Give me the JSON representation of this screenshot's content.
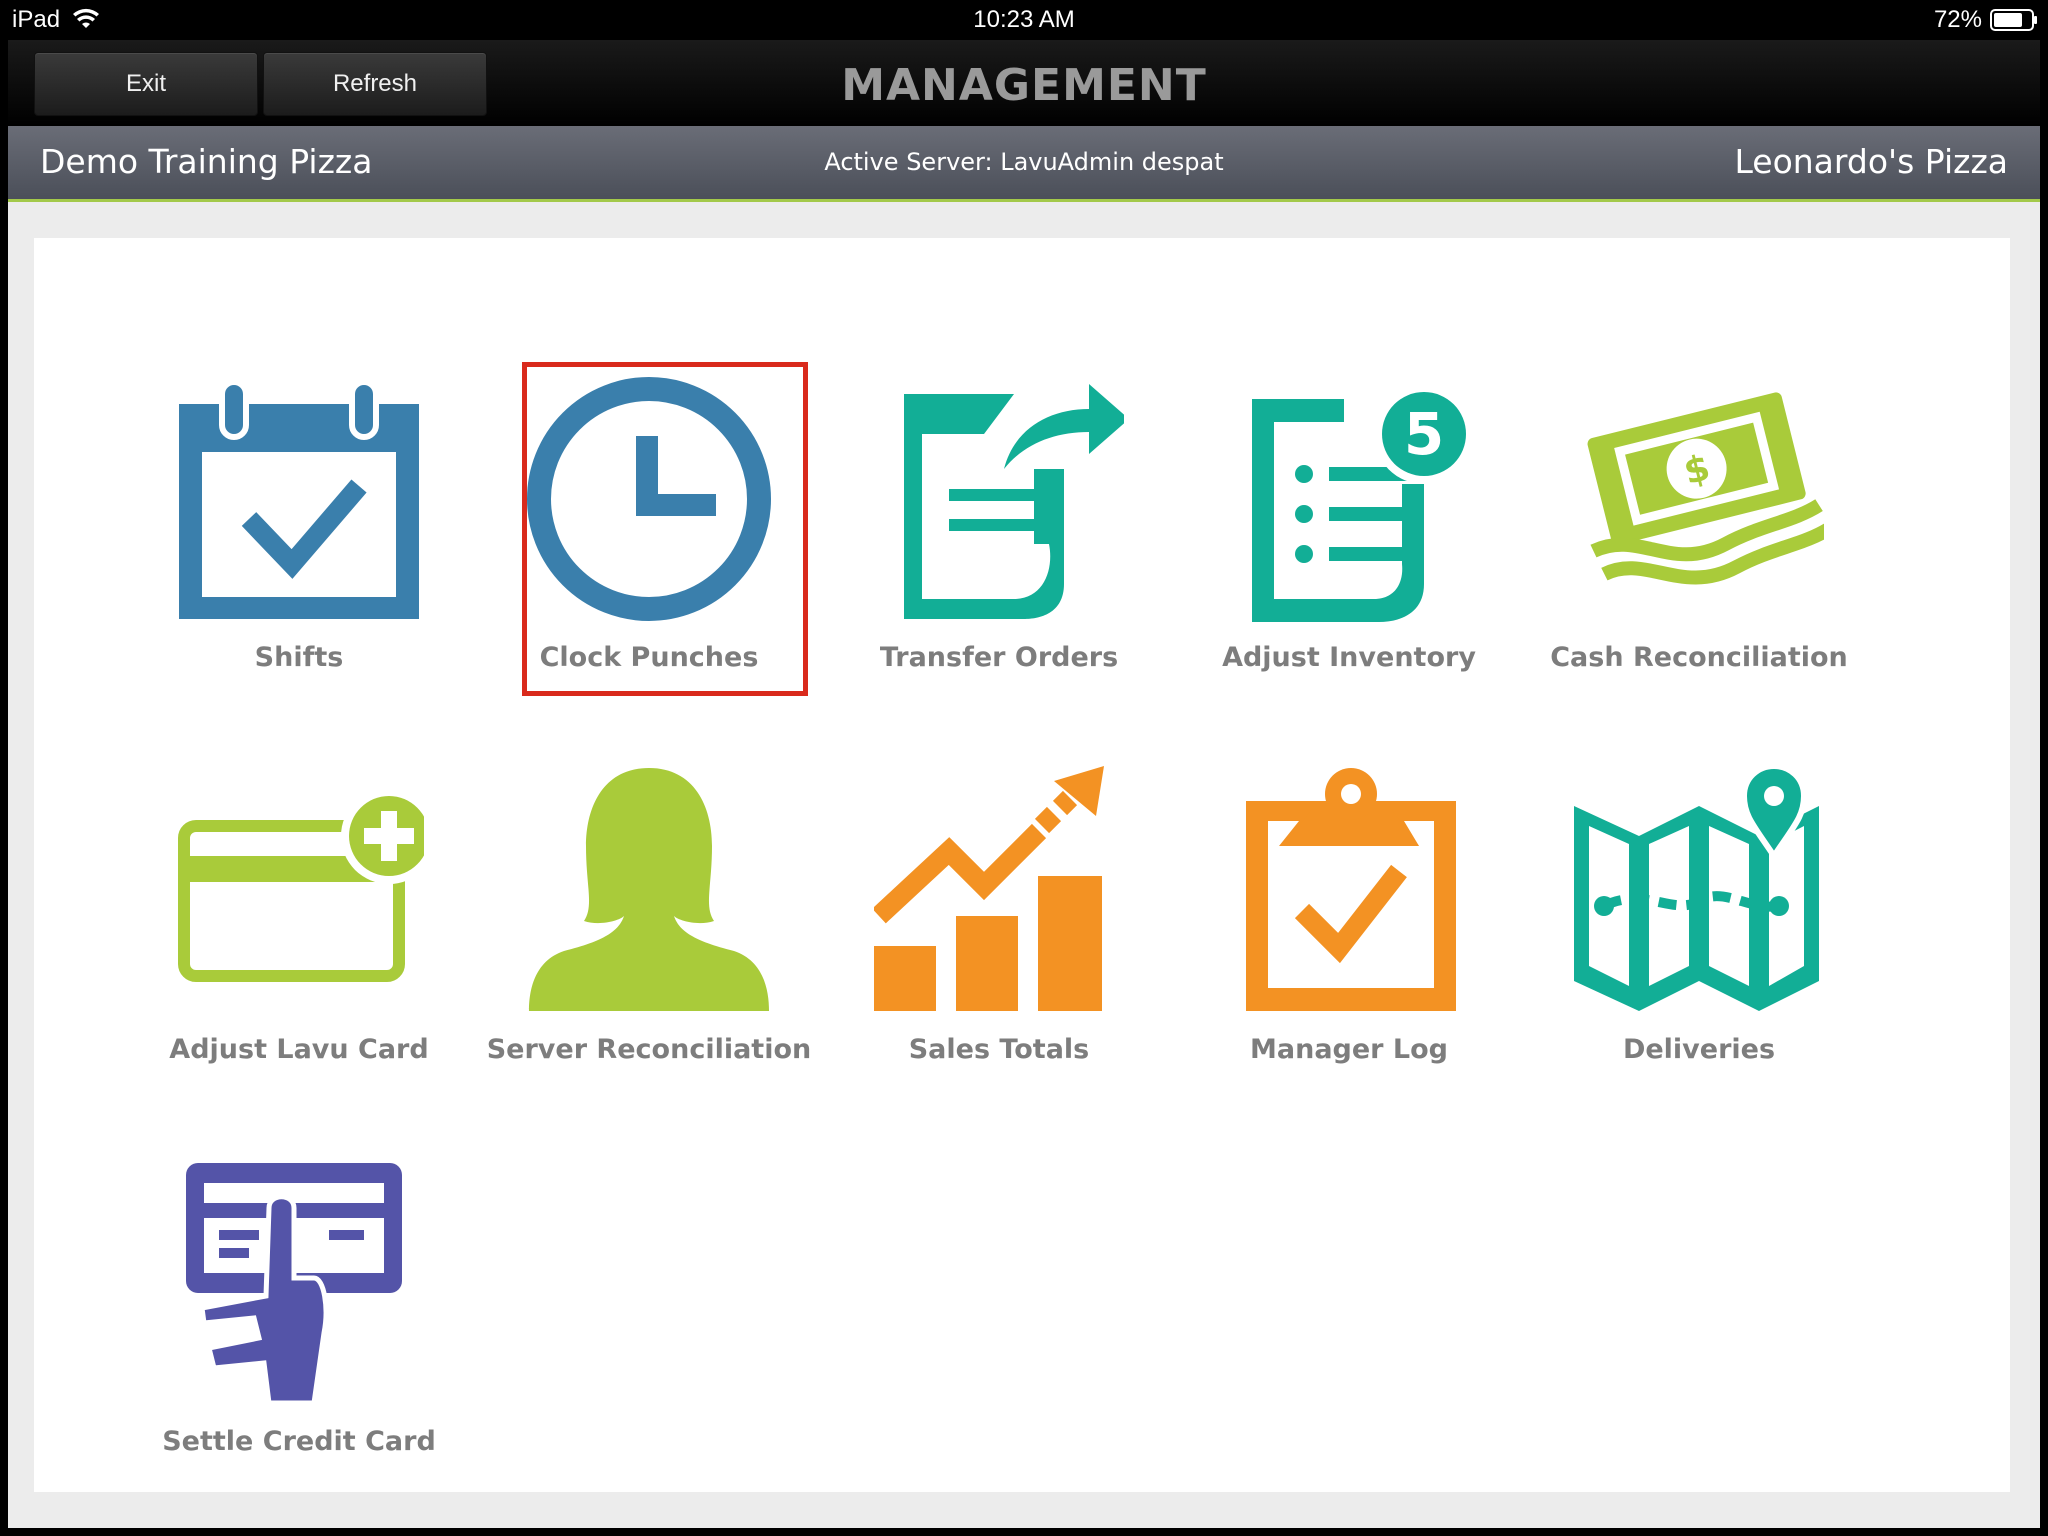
{
  "status_bar": {
    "carrier": "iPad",
    "time": "10:23 AM",
    "battery": "72%"
  },
  "header": {
    "exit_label": "Exit",
    "refresh_label": "Refresh",
    "title": "MANAGEMENT"
  },
  "subheader": {
    "location": "Demo Training Pizza",
    "active_server": "Active Server: LavuAdmin despat",
    "restaurant": "Leonardo's Pizza"
  },
  "tiles": [
    {
      "label": "Shifts",
      "icon": "calendar-check-icon",
      "color": "#3a7fac"
    },
    {
      "label": "Clock Punches",
      "icon": "clock-icon",
      "color": "#3a7fac",
      "selected": true
    },
    {
      "label": "Transfer Orders",
      "icon": "document-transfer-icon",
      "color": "#12ae96"
    },
    {
      "label": "Adjust Inventory",
      "icon": "inventory-list-icon",
      "color": "#12ae96",
      "badge": "5"
    },
    {
      "label": "Cash Reconciliation",
      "icon": "cash-money-icon",
      "color": "#a9cb3a",
      "symbol": "$"
    },
    {
      "label": "Adjust Lavu Card",
      "icon": "card-add-icon",
      "color": "#a9cb3a"
    },
    {
      "label": "Server Reconciliation",
      "icon": "person-icon",
      "color": "#a9cb3a"
    },
    {
      "label": "Sales Totals",
      "icon": "sales-chart-icon",
      "color": "#f39223"
    },
    {
      "label": "Manager Log",
      "icon": "clipboard-check-icon",
      "color": "#f39223"
    },
    {
      "label": "Deliveries",
      "icon": "map-pin-icon",
      "color": "#12ae96"
    },
    {
      "label": "Settle Credit Card",
      "icon": "hand-card-icon",
      "color": "#5454a8"
    }
  ],
  "selection_color": "#d92a1c"
}
